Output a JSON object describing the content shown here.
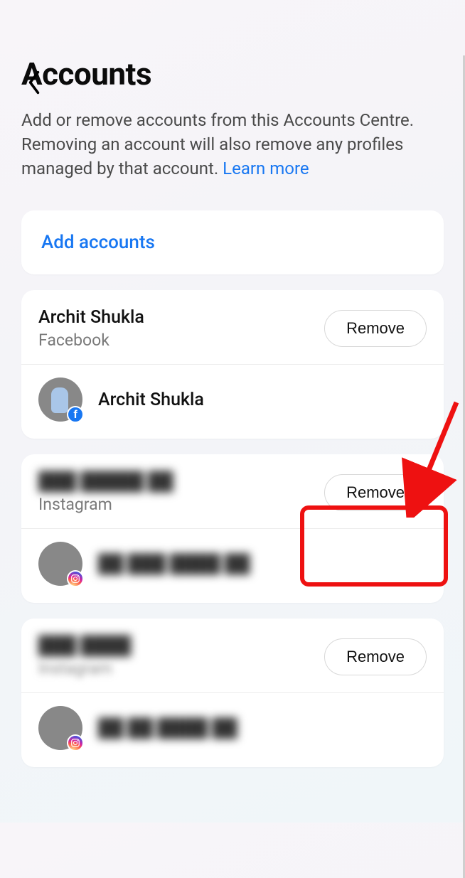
{
  "header": {
    "title": "Accounts",
    "description_pre": "Add or remove accounts from this Accounts Centre. Removing an account will also remove any profiles managed by that account. ",
    "learn_more": "Learn more"
  },
  "add_accounts_label": "Add accounts",
  "accounts": [
    {
      "name": "Archit Shukla",
      "platform": "Facebook",
      "remove_label": "Remove",
      "profile_name": "Archit Shukla",
      "badge": "facebook"
    },
    {
      "name": "███ █████ ██",
      "platform": "Instagram",
      "remove_label": "Remove",
      "profile_name": "██ ███ ████ ██",
      "badge": "instagram"
    },
    {
      "name": "███ ████",
      "platform": "Instagram",
      "remove_label": "Remove",
      "profile_name": "██ ██ ████ ██",
      "badge": "instagram"
    }
  ],
  "annotation": {
    "highlight_account_index": 1,
    "colors": {
      "highlight": "#e11",
      "link": "#1877f2"
    }
  }
}
